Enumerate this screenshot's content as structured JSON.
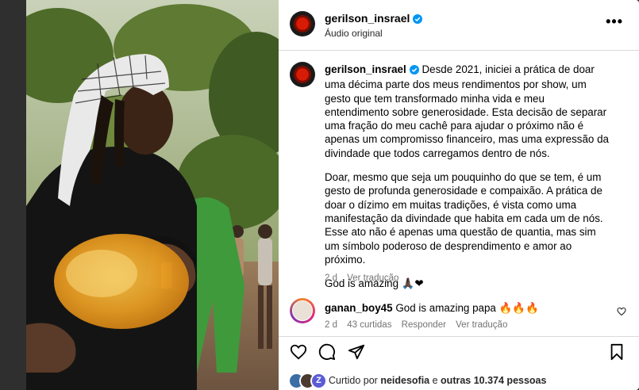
{
  "post": {
    "username": "gerilson_insrael",
    "audio": "Áudio original",
    "more_label": "•••"
  },
  "caption": {
    "username": "gerilson_insrael",
    "paragraph1": "Desde 2021, iniciei a prática de doar uma décima parte dos meus rendimentos por show, um gesto que tem transformado minha vida e meu entendimento sobre generosidade. Esta decisão de separar uma fração do meu cachê para ajudar o próximo não é apenas um compromisso financeiro, mas uma expressão da divindade que todos carregamos dentro de nós.",
    "paragraph2": "Doar, mesmo que seja um pouquinho do que se tem, é um gesto de profunda generosidade e compaixão. A prática de doar o dízimo em muitas tradições, é vista como uma manifestação da divindade que habita em cada um de nós. Esse ato não é apenas uma questão de quantia, mas sim um símbolo poderoso de desprendimento e amor ao próximo.",
    "paragraph3": "God is amazing 🙏🏿❤",
    "time": "2 d",
    "translate": "Ver tradução"
  },
  "comment": {
    "username": "ganan_boy45",
    "text": "God is amazing papa 🔥🔥🔥",
    "time": "2 d",
    "likes": "43 curtidas",
    "reply": "Responder",
    "translate": "Ver tradução"
  },
  "likes": {
    "prefix": "Curtido por ",
    "user": "neidesofia",
    "middle": " e ",
    "others": "outras 10.374 pessoas"
  },
  "icons": {
    "like": "heart-icon",
    "comment": "comment-icon",
    "share": "share-icon",
    "save": "bookmark-icon",
    "verified": "verified-badge-icon",
    "more": "more-icon"
  },
  "colors": {
    "verified": "#0095f6",
    "secondary_text": "#737373",
    "background": "#2f2f2f"
  }
}
